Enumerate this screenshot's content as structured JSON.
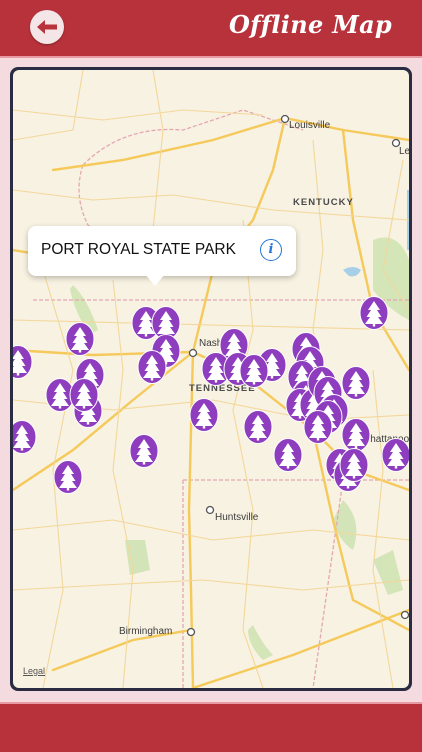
{
  "header": {
    "title": "Offline Map",
    "back_icon": "back-arrow-icon"
  },
  "map": {
    "cities": [
      "Louisville",
      "Le",
      "Nashville",
      "Huntsville",
      "Birmingham",
      "Chattanooga"
    ],
    "states": [
      "KENTUCKY",
      "TENNESSEE"
    ],
    "legal": "Legal",
    "marker_icon": "tree-pin-icon",
    "marker_color": "#8e3dbf",
    "marker_count": 39
  },
  "callout": {
    "title": "PORT ROYAL STATE PARK",
    "info_icon": "info-icon"
  },
  "colors": {
    "bar": "#b8323c",
    "accent_border": "#e79aa3",
    "road": "#f5c95a",
    "land": "#f8f2e2"
  }
}
